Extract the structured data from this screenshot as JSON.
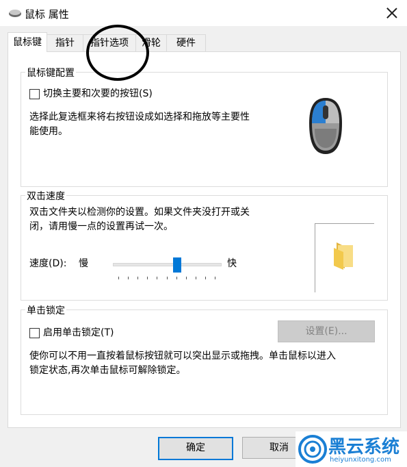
{
  "window": {
    "title": "鼠标 属性",
    "close_label": "×"
  },
  "tabs": [
    {
      "label": "鼠标键",
      "active": true
    },
    {
      "label": "指针"
    },
    {
      "label": "指针选项"
    },
    {
      "label": "滑轮"
    },
    {
      "label": "硬件"
    }
  ],
  "button_config": {
    "group_label": "鼠标键配置",
    "swap_checkbox_label": "切换主要和次要的按钮(S)",
    "swap_checked": false,
    "description": [
      "选择此复选框来将右按钮设成如选择和拖放等主要性",
      "能使用。"
    ]
  },
  "double_click": {
    "group_label": "双击速度",
    "description": [
      "双击文件夹以检测你的设置。如果文件夹没打开或关",
      "闭，请用慢一点的设置再试一次。"
    ],
    "speed_label": "速度(D):",
    "slow_label": "慢",
    "fast_label": "快",
    "speed_value_fraction": 0.6
  },
  "click_lock": {
    "group_label": "单击锁定",
    "checkbox_label": "启用单击锁定(T)",
    "checked": false,
    "settings_button": "设置(E)...",
    "description": [
      "使你可以不用一直按着鼠标按钮就可以突出显示或拖拽。单击鼠标以进入",
      "锁定状态,再次单击鼠标可解除锁定。"
    ]
  },
  "footer": {
    "ok_button": "确定",
    "cancel_button": "取消"
  },
  "watermark": {
    "brand": "黑云系统",
    "url": "heiyunxitong.com"
  },
  "colors": {
    "accent": "#0078d7",
    "watermark_blue": "#1a7fd4"
  }
}
